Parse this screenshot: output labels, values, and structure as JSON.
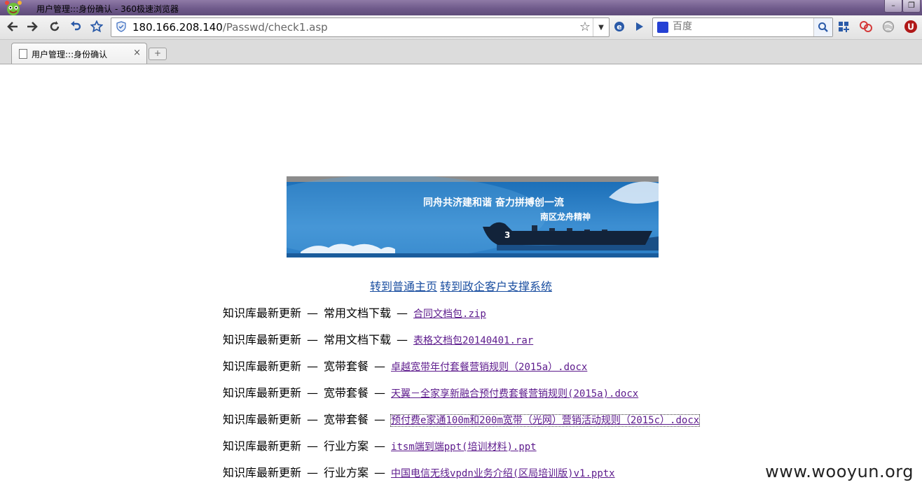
{
  "window": {
    "title": "用户管理:::身份确认 - 360极速浏览器",
    "minimize": "–",
    "restore": "❐"
  },
  "toolbar": {
    "url_host": "180.166.208.140",
    "url_path": "/Passwd/check1.asp",
    "search_placeholder": "百度",
    "icons": [
      "back-icon",
      "forward-icon",
      "reload-icon",
      "undo-icon",
      "bookmark-star-icon",
      "security-shield-icon",
      "ie-mode-icon",
      "play-icon",
      "apps-icon",
      "extension-icon",
      "globe-icon",
      "user-u-icon"
    ]
  },
  "tabs": [
    {
      "label": "用户管理:::身份确认",
      "close": "×"
    }
  ],
  "new_tab": "+",
  "banner": {
    "slogan_line1": "同舟共济建和谐 奋力拼搏创一流",
    "slogan_line2": "南区龙舟精神",
    "boat_number": "3"
  },
  "quick_links": [
    {
      "label": "转到普通主页"
    },
    {
      "label": "转到政企客户支撑系统"
    }
  ],
  "kb_rows": [
    {
      "prefix": "知识库最新更新",
      "category": "常用文档下载",
      "file": "合同文档包.zip"
    },
    {
      "prefix": "知识库最新更新",
      "category": "常用文档下载",
      "file": "表格文档包20140401.rar"
    },
    {
      "prefix": "知识库最新更新",
      "category": "宽带套餐",
      "file": "卓越宽带年付套餐营销规则（2015a）.docx"
    },
    {
      "prefix": "知识库最新更新",
      "category": "宽带套餐",
      "file": "天翼－全家享新融合预付费套餐营销规则(2015a).docx"
    },
    {
      "prefix": "知识库最新更新",
      "category": "宽带套餐",
      "file": "预付费e家通100m和200m宽带（光网）营销活动规则（2015c）.docx"
    },
    {
      "prefix": "知识库最新更新",
      "category": "行业方案",
      "file": "itsm端到端ppt(培训材料).ppt"
    },
    {
      "prefix": "知识库最新更新",
      "category": "行业方案",
      "file": "中国电信无线vpdn业务介绍(区局培训版)v1.pptx"
    }
  ],
  "separator": "—",
  "watermark": "www.wooyun.org"
}
